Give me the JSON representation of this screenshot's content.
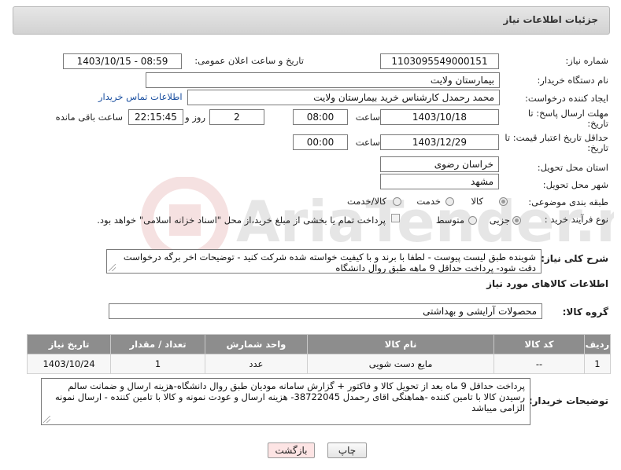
{
  "panel": {
    "title": "جزئیات اطلاعات نیاز"
  },
  "form": {
    "need_number": {
      "label": "شماره نیاز:",
      "value": "1103095549000151"
    },
    "announce_datetime": {
      "label": "تاریخ و ساعت اعلان عمومی:",
      "value": "1403/10/15 - 08:59"
    },
    "buyer_org": {
      "label": "نام دستگاه خریدار:",
      "value": "بیمارستان ولایت"
    },
    "requester": {
      "label": "ایجاد کننده درخواست:",
      "value": "محمد رحمدل کارشناس خرید بیمارستان ولایت",
      "contact_link": "اطلاعات تماس خریدار"
    },
    "reply_deadline": {
      "label_line1": "مهلت ارسال پاسخ: تا",
      "label_line2": "تاریخ:",
      "date": "1403/10/18",
      "time_label": "ساعت",
      "time": "08:00",
      "days": "2",
      "days_label": "روز و",
      "remaining": "22:15:45",
      "remaining_label": "ساعت باقی مانده"
    },
    "price_validity": {
      "label_line1": "حداقل تاریخ اعتبار قیمت: تا",
      "label_line2": "تاریخ:",
      "date": "1403/12/29",
      "time_label": "ساعت",
      "time": "00:00"
    },
    "delivery_province": {
      "label": "استان محل تحویل:",
      "value": "خراسان رضوی"
    },
    "delivery_city": {
      "label": "شهر محل تحویل:",
      "value": "مشهد"
    },
    "category": {
      "label": "طبقه بندی موضوعی:",
      "options": [
        "کالا",
        "خدمت",
        "کالا/خدمت"
      ],
      "selected": "کالا"
    },
    "process_type": {
      "label": "نوع فرآیند خرید :",
      "options": [
        "جزیی",
        "متوسط"
      ],
      "selected": "جزیی",
      "payment_note": "پرداخت تمام یا بخشی از مبلغ خرید،از محل \"اسناد خزانه اسلامی\" خواهد بود."
    },
    "description": {
      "label": "شرح کلی نیاز:",
      "value": "شوینده طبق لیست پیوست - لطفا با برند و با کیفیت خواسته شده شرکت کنید - توضیحات اخر برگه درخواست دقت شود- پرداخت حداقل 9 ماهه طبق روال دانشگاه"
    }
  },
  "goods": {
    "section_title": "اطلاعات کالاهای مورد نیاز",
    "group_label": "گروه کالا:",
    "group_value": "محصولات آرایشی و بهداشتی",
    "columns": [
      "ردیف",
      "کد کالا",
      "نام کالا",
      "واحد شمارش",
      "تعداد / مقدار",
      "تاریخ نیاز"
    ],
    "rows": [
      {
        "row": "1",
        "code": "--",
        "name": "مایع دست شویی",
        "unit": "عدد",
        "qty": "1",
        "date": "1403/10/24"
      }
    ]
  },
  "buyer_notes": {
    "label": "توضیحات خریدار:",
    "value": "پرداخت حداقل 9 ماه بعد از تحویل کالا و فاکتور + گزارش سامانه مودیان طبق روال دانشگاه-هزینه ارسال و ضمانت سالم رسیدن کالا با تامین کننده -هماهنگی اقای رحمدل 38722045-  هزینه ارسال و عودت نمونه و کالا با تامین کننده - ارسال نمونه الزامی میباشد"
  },
  "buttons": {
    "print": "چاپ",
    "back": "بازگشت"
  },
  "watermark_text": "AriaTender.net",
  "colors": {
    "table_header": "#8d8d8d",
    "link": "#1a4fa0",
    "back_button_bg": "#fde4e4"
  }
}
